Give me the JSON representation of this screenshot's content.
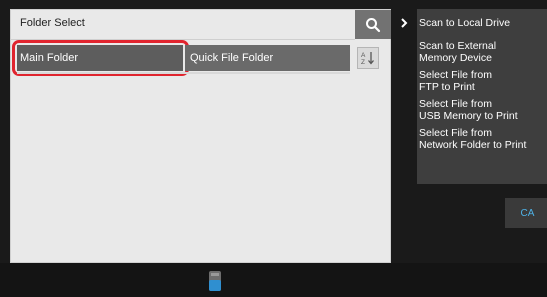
{
  "panel": {
    "title": "Folder Select",
    "search_icon": "search-icon",
    "tabs": [
      {
        "label": "Main Folder",
        "selected": true
      },
      {
        "label": "Quick File Folder",
        "selected": false
      }
    ],
    "sort_icon": "sort-az-icon"
  },
  "side_menu": {
    "arrow_icon": "chevron-right-icon",
    "items": [
      {
        "line1": "Scan to Local Drive",
        "line2": ""
      },
      {
        "line1": "Scan to External",
        "line2": "Memory Device"
      },
      {
        "line1": "Select File from",
        "line2": "FTP to Print"
      },
      {
        "line1": "Select File from",
        "line2": "USB Memory to Print"
      },
      {
        "line1": "Select File from",
        "line2": "Network Folder to Print"
      }
    ]
  },
  "ca_button": {
    "label": "CA",
    "color": "#4fb3e8"
  },
  "bottom_bar": {
    "icon": "storage-device-icon"
  },
  "colors": {
    "highlight": "#e0242e",
    "tab_selected": "#5d5d5d",
    "panel_bg": "#e9e9e9"
  }
}
